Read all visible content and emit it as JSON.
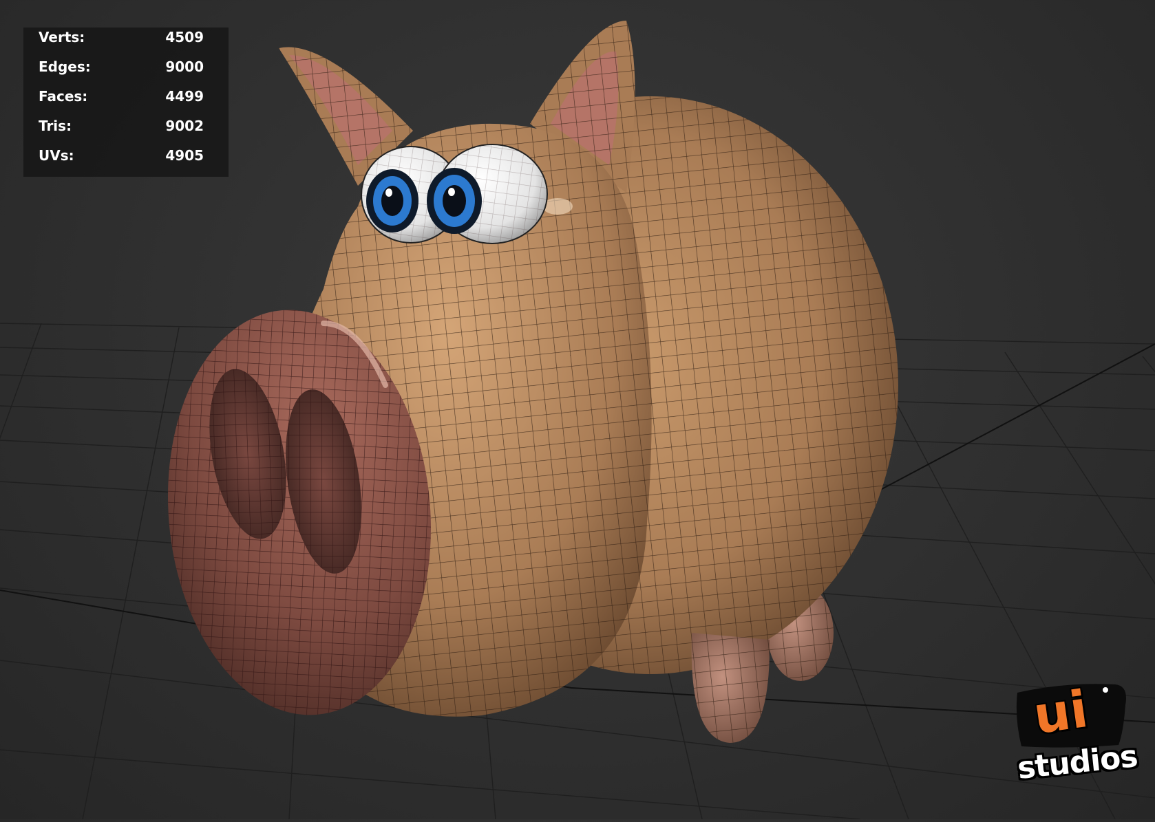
{
  "stats": [
    {
      "label": "Verts:",
      "value": "4509"
    },
    {
      "label": "Edges:",
      "value": "9000"
    },
    {
      "label": "Faces:",
      "value": "4499"
    },
    {
      "label": "Tris:",
      "value": "9002"
    },
    {
      "label": "UVs:",
      "value": "4905"
    }
  ],
  "logo": {
    "mark": "ui",
    "text": "studios"
  },
  "colors": {
    "background": "#2f2f2f",
    "grid_line": "#1a1a1a",
    "skin": "#b8885f",
    "snout": "#8a5248",
    "iris": "#1f6fc4",
    "logo_orange": "#f07628"
  },
  "icons": [
    "pig-model",
    "viewport-grid",
    "ui-studios-logo"
  ]
}
